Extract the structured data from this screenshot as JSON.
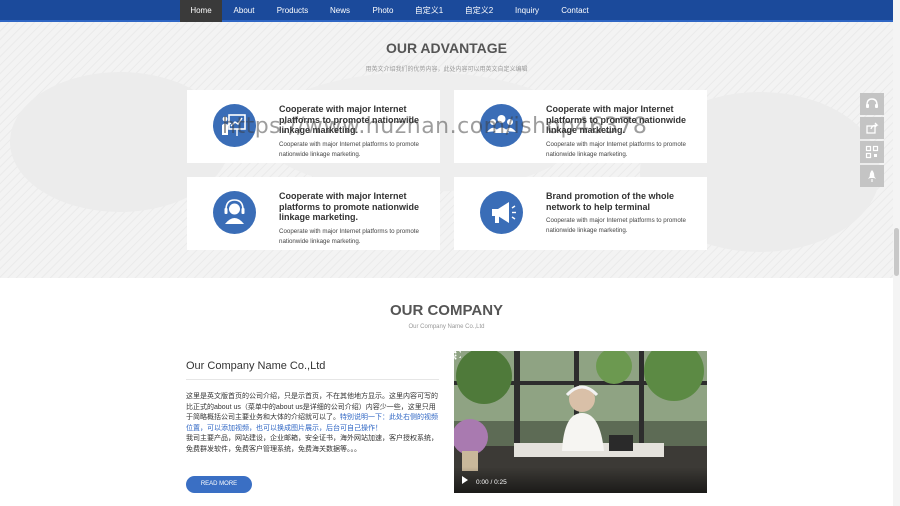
{
  "nav": {
    "items": [
      {
        "label": "Home",
        "active": true
      },
      {
        "label": "About"
      },
      {
        "label": "Products"
      },
      {
        "label": "News"
      },
      {
        "label": "Photo"
      },
      {
        "label": "自定义1"
      },
      {
        "label": "自定义2"
      },
      {
        "label": "Inquiry"
      },
      {
        "label": "Contact"
      }
    ]
  },
  "advantage": {
    "title": "OUR ADVANTAGE",
    "subtitle": "用英文介绍我们的优势内容，此处内容可以用英文自定义编辑",
    "cards": [
      {
        "title": "Cooperate with major Internet platforms to promote nationwide linkage marketing.",
        "desc": "Cooperate with major Internet platforms to promote nationwide linkage marketing.",
        "icon": "presentation-icon"
      },
      {
        "title": "Cooperate with major Internet platforms to promote nationwide linkage marketing.",
        "desc": "Cooperate with major Internet platforms to promote nationwide linkage marketing.",
        "icon": "team-icon"
      },
      {
        "title": "Cooperate with major Internet platforms to promote nationwide linkage marketing.",
        "desc": "Cooperate with major Internet platforms to promote nationwide linkage marketing.",
        "icon": "support-icon"
      },
      {
        "title": "Brand promotion of the whole network to help terminal",
        "desc": "Cooperate with major Internet platforms to promote nationwide linkage marketing.",
        "icon": "megaphone-icon"
      }
    ]
  },
  "company": {
    "title": "OUR COMPANY",
    "subtitle": "Our Company Name Co.,Ltd",
    "name": "Our Company Name Co.,Ltd",
    "intro_part1": "这里是英文版首页的公司介绍，只是示首页，不在其他地方显示。这里内容可写的比正式的about us（菜单中的about us是详细的公司介绍）内容少一些，这里只用于简略概括公司主要业务和大体的介绍就可以了。",
    "intro_highlight": "特别说明一下：此处右侧的视频位置，可以添加视频，也可以换成图片展示，后台可自己操作！",
    "intro_part2": "我司主要产品，网站建设，企业邮箱，安全证书，海外网站加速，客户授权系统，免费群发软件，免费客户管理系统，免费海关数据等。。。",
    "read_more": "READ MORE"
  },
  "video": {
    "time": "0:00 / 0:25",
    "progress": 0
  },
  "side_tools": [
    {
      "icon": "headset-icon"
    },
    {
      "icon": "share-icon"
    },
    {
      "icon": "qrcode-icon"
    },
    {
      "icon": "rocket-icon"
    }
  ],
  "watermark": "https://www.huzhan.com/ishop46378",
  "colors": {
    "nav_bg": "#1b4a9b",
    "accent": "#3a6db7",
    "button": "#3a6fc4"
  }
}
